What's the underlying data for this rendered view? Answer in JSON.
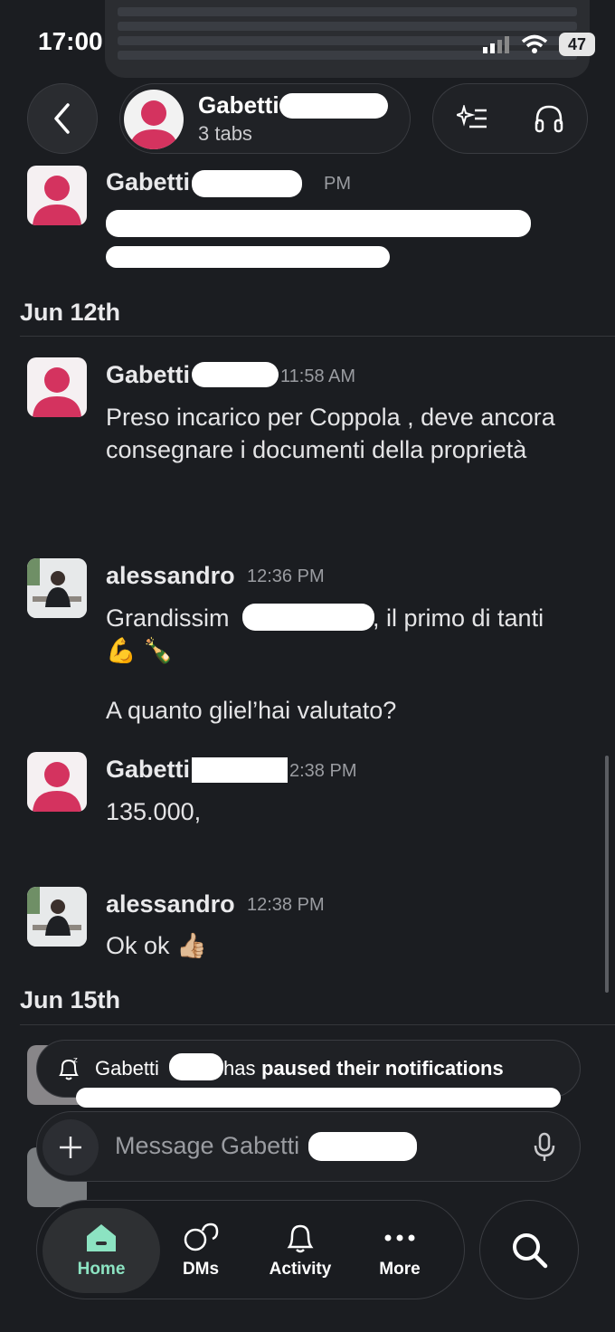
{
  "status": {
    "time": "17:00",
    "battery": "47"
  },
  "header": {
    "contact_name": "Gabetti",
    "subtitle": "3 tabs"
  },
  "messages": [
    {
      "author": "Gabetti",
      "time": "PM",
      "text": ""
    },
    {
      "author": "Gabetti",
      "time": "11:58 AM",
      "text": "Preso incarico per Coppola , deve ancora consegnare i documenti della proprietà"
    },
    {
      "author": "alessandro",
      "time": "12:36 PM",
      "text_a": "Grandissim",
      "text_b": ", il primo di tanti",
      "emoji": "💪 🍾",
      "text2": "A quanto gliel’hai valutato?"
    },
    {
      "author": "Gabetti",
      "time": "2:38 PM",
      "text": "135.000,"
    },
    {
      "author": "alessandro",
      "time": "12:38 PM",
      "text": "Ok ok 👍🏼"
    }
  ],
  "days": {
    "jun12": "Jun 12th",
    "jun15": "Jun 15th"
  },
  "toast": {
    "name": "Gabetti",
    "text_plain": "has",
    "text_bold": "paused their notifications"
  },
  "composer": {
    "placeholder": "Message Gabetti"
  },
  "tabbar": {
    "home": "Home",
    "dms": "DMs",
    "activity": "Activity",
    "more": "More"
  },
  "colors": {
    "accent": "#8ce3c2",
    "background": "#1b1d21",
    "avatar_red": "#d4335f"
  }
}
